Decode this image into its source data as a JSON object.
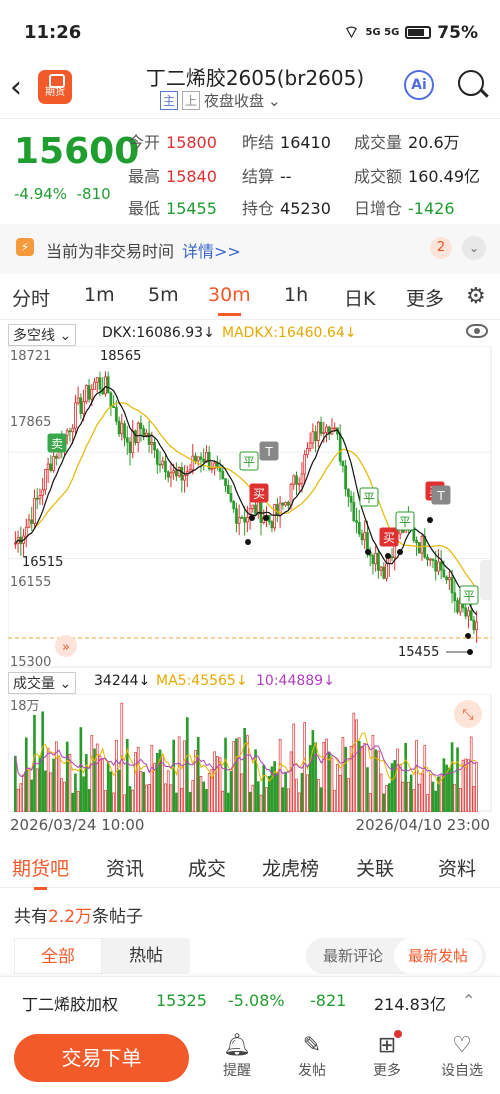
{
  "status": {
    "time": "11:26",
    "battery": "75%",
    "signal": "5G 5G"
  },
  "header": {
    "title": "丁二烯胶2605(br2605)",
    "logo_text": "期货",
    "tag_main": "主",
    "tag_up": "上",
    "session": "夜盘收盘",
    "ai_label": "Ai"
  },
  "quote": {
    "price": "15600",
    "change_pct": "-4.94%",
    "change": "-810",
    "items": [
      {
        "k": "今开",
        "v": "15800",
        "c": "red"
      },
      {
        "k": "昨结",
        "v": "16410",
        "c": ""
      },
      {
        "k": "成交量",
        "v": "20.6万",
        "c": ""
      },
      {
        "k": "最高",
        "v": "15840",
        "c": "red"
      },
      {
        "k": "结算",
        "v": "--",
        "c": ""
      },
      {
        "k": "成交额",
        "v": "160.49亿",
        "c": ""
      },
      {
        "k": "最低",
        "v": "15455",
        "c": "green"
      },
      {
        "k": "持仓",
        "v": "45230",
        "c": ""
      },
      {
        "k": "日增仓",
        "v": "-1426",
        "c": "green"
      }
    ]
  },
  "notice": {
    "text": "当前为非交易时间",
    "link": "详情>>",
    "count": "2"
  },
  "period_tabs": [
    "分时",
    "1m",
    "5m",
    "30m",
    "1h",
    "日K",
    "更多"
  ],
  "indicator": {
    "name": "多空线",
    "dkx": "DKX:16086.93↓",
    "madkx": "MADKX:16460.64↓"
  },
  "volume": {
    "name": "成交量",
    "value": "34244↓",
    "ma5": "MA5:45565↓",
    "ma10": "10:44889↓"
  },
  "dates": {
    "start": "2026/03/24 10:00",
    "end": "2026/04/10 23:00"
  },
  "bottom_tabs": [
    "期货吧",
    "资讯",
    "成交",
    "龙虎榜",
    "关联",
    "资料"
  ],
  "posts": {
    "prefix": "共有",
    "count": "2.2万",
    "suffix": "条帖子"
  },
  "filters": {
    "all": "全部",
    "hot": "热帖",
    "latest_comment": "最新评论",
    "latest_post": "最新发帖"
  },
  "ticker": {
    "name": "丁二烯胶加权",
    "price": "15325",
    "pct": "-5.08%",
    "chg": "-821",
    "amount": "214.83亿"
  },
  "bottom_bar": {
    "trade": "交易下单",
    "alert": "提醒",
    "post": "发帖",
    "more": "更多",
    "watch": "设自选"
  },
  "chart_data": {
    "type": "candlestick",
    "y_axis_labels": [
      "18721",
      "17865",
      "16155",
      "15300"
    ],
    "annotations": {
      "high": "18565",
      "low_left": "16515",
      "low_right": "15455",
      "volume_axis": "18万"
    },
    "signals": [
      "卖",
      "平",
      "T",
      "买",
      "平",
      "买",
      "平",
      "买",
      "T",
      "平"
    ],
    "close_path": [
      16600,
      16800,
      17100,
      17500,
      17700,
      18000,
      18200,
      18400,
      18300,
      17900,
      17700,
      17900,
      17600,
      17500,
      17300,
      17400,
      17600,
      17500,
      17200,
      16950,
      16900,
      17000,
      16850,
      16950,
      17200,
      17500,
      17800,
      18000,
      17700,
      17100,
      16700,
      16500,
      16300,
      16700,
      16800,
      16600,
      16500,
      16300,
      16000,
      15800,
      15600
    ]
  }
}
